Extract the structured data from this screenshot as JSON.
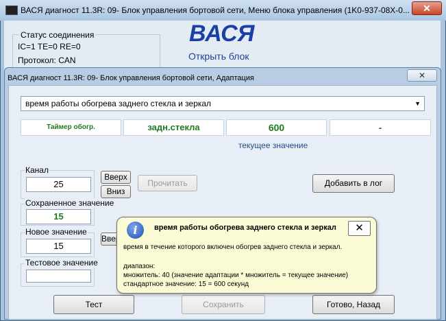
{
  "back_window": {
    "title": "ВАСЯ диагност 11.3R: 09- Блок управления бортовой сети,   Меню блока управления (1K0-937-08X-0...",
    "close_glyph": "✕",
    "status_group_label": "Статус соединения",
    "status_counters": "IC=1  TE=0   RE=0",
    "protocol": "Протокол: CAN",
    "brand": "ВАСЯ",
    "open_block": "Открыть блок"
  },
  "dialog": {
    "title": "ВАСЯ диагност 11.3R: 09- Блок управления бортовой сети, Адаптация",
    "close_glyph": "✕",
    "function_select": "время работы обогрева заднего стекла и зеркал",
    "select_arrow": "▼",
    "cells": [
      "Таймер обогр.",
      "задн.стекла",
      "600",
      "-"
    ],
    "current_value_label": "текущее значение",
    "channel_label": "Канал",
    "channel_value": "25",
    "up_button": "Вверх",
    "down_button": "Вниз",
    "read_button": "Прочитать",
    "log_button": "Добавить в лог",
    "saved_label": "Сохраненное значение",
    "saved_value": "15",
    "new_label": "Новое значение",
    "new_value": "15",
    "up_button_2": "Вверх",
    "test_label": "Тестовое значение",
    "test_value": "",
    "test_button": "Тест",
    "save_button": "Сохранить",
    "done_button": "Готово, Назад"
  },
  "tooltip": {
    "icon": "i",
    "title": "время работы обогрева заднего стекла и зеркал",
    "close_glyph": "✕",
    "line1": "время в течение которого включен обогрев заднего стекла и зеркал.",
    "line2": "диапазон:",
    "line3": "множитель: 40 (значение адаптации * множитель = текущее значение)",
    "line4": "стандартное значение: 15 = 600 секунд"
  },
  "colors": {
    "value_green": "#1f7a1f",
    "brand_blue": "#1a3fa6",
    "tooltip_bg": "#fbfbd6"
  }
}
